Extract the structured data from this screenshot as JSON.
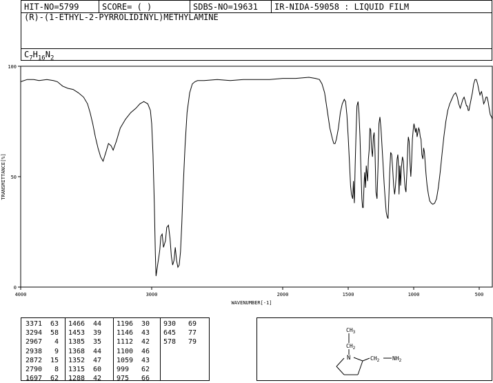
{
  "header": {
    "hit_no": "HIT-NO=5799",
    "score": "SCORE=  (   )",
    "sdbs_no": "SDBS-NO=19631",
    "ir_info": "IR-NIDA-59058 : LIQUID FILM"
  },
  "compound_name": "(R)-(1-ETHYL-2-PYRROLIDINYL)METHYLAMINE",
  "formula": {
    "parts": [
      "C",
      "7",
      "H",
      "16",
      "N",
      "2"
    ]
  },
  "chart_data": {
    "type": "line",
    "title": "",
    "xlabel": "WAVENUMBER[-1]",
    "ylabel": "TRANSMITTANCE[%]",
    "xlim": [
      4000,
      400
    ],
    "ylim": [
      0,
      100
    ],
    "x_ticks": [
      4000,
      3000,
      2000,
      1500,
      1000,
      500
    ],
    "y_ticks": [
      0,
      50,
      100
    ],
    "grid": false,
    "series": [
      {
        "points": [
          [
            4000,
            93
          ],
          [
            3950,
            94
          ],
          [
            3900,
            94
          ],
          [
            3860,
            93.5
          ],
          [
            3800,
            94
          ],
          [
            3750,
            93.5
          ],
          [
            3720,
            93
          ],
          [
            3700,
            92
          ],
          [
            3680,
            91
          ],
          [
            3640,
            90
          ],
          [
            3600,
            89.5
          ],
          [
            3560,
            88
          ],
          [
            3520,
            86
          ],
          [
            3490,
            83
          ],
          [
            3470,
            79
          ],
          [
            3450,
            74
          ],
          [
            3430,
            68
          ],
          [
            3410,
            63
          ],
          [
            3390,
            59
          ],
          [
            3371,
            57
          ],
          [
            3350,
            61
          ],
          [
            3330,
            65
          ],
          [
            3310,
            64
          ],
          [
            3294,
            62
          ],
          [
            3270,
            66
          ],
          [
            3240,
            72
          ],
          [
            3200,
            76
          ],
          [
            3160,
            79
          ],
          [
            3120,
            81
          ],
          [
            3090,
            83
          ],
          [
            3060,
            84
          ],
          [
            3030,
            83
          ],
          [
            3010,
            80
          ],
          [
            3000,
            74
          ],
          [
            2990,
            60
          ],
          [
            2980,
            38
          ],
          [
            2972,
            15
          ],
          [
            2967,
            5
          ],
          [
            2955,
            10
          ],
          [
            2945,
            14
          ],
          [
            2938,
            17
          ],
          [
            2930,
            23
          ],
          [
            2920,
            24
          ],
          [
            2910,
            18
          ],
          [
            2895,
            21
          ],
          [
            2885,
            27
          ],
          [
            2872,
            28
          ],
          [
            2860,
            22
          ],
          [
            2850,
            14
          ],
          [
            2840,
            10
          ],
          [
            2830,
            12
          ],
          [
            2820,
            18
          ],
          [
            2810,
            12
          ],
          [
            2800,
            9
          ],
          [
            2790,
            10
          ],
          [
            2780,
            16
          ],
          [
            2770,
            29
          ],
          [
            2760,
            45
          ],
          [
            2745,
            64
          ],
          [
            2730,
            79
          ],
          [
            2710,
            88
          ],
          [
            2690,
            92
          ],
          [
            2670,
            93
          ],
          [
            2650,
            93.5
          ],
          [
            2600,
            93.5
          ],
          [
            2500,
            94
          ],
          [
            2400,
            93.5
          ],
          [
            2300,
            94
          ],
          [
            2200,
            94
          ],
          [
            2100,
            94
          ],
          [
            2000,
            94.5
          ],
          [
            1900,
            94.5
          ],
          [
            1800,
            95
          ],
          [
            1750,
            94.5
          ],
          [
            1720,
            94
          ],
          [
            1700,
            92
          ],
          [
            1680,
            88
          ],
          [
            1660,
            80
          ],
          [
            1640,
            72
          ],
          [
            1620,
            67
          ],
          [
            1610,
            65
          ],
          [
            1600,
            65
          ],
          [
            1590,
            67
          ],
          [
            1575,
            72
          ],
          [
            1560,
            79
          ],
          [
            1545,
            83
          ],
          [
            1530,
            85
          ],
          [
            1520,
            84
          ],
          [
            1510,
            78
          ],
          [
            1500,
            68
          ],
          [
            1490,
            56
          ],
          [
            1482,
            46
          ],
          [
            1475,
            42
          ],
          [
            1466,
            40
          ],
          [
            1460,
            48
          ],
          [
            1453,
            38
          ],
          [
            1447,
            55
          ],
          [
            1440,
            70
          ],
          [
            1433,
            82
          ],
          [
            1425,
            84
          ],
          [
            1418,
            79
          ],
          [
            1410,
            68
          ],
          [
            1402,
            52
          ],
          [
            1396,
            40
          ],
          [
            1390,
            36
          ],
          [
            1385,
            36
          ],
          [
            1378,
            48
          ],
          [
            1374,
            52
          ],
          [
            1368,
            45
          ],
          [
            1362,
            55
          ],
          [
            1358,
            52
          ],
          [
            1352,
            48
          ],
          [
            1346,
            58
          ],
          [
            1340,
            62
          ],
          [
            1334,
            72
          ],
          [
            1328,
            71
          ],
          [
            1322,
            63
          ],
          [
            1315,
            59
          ],
          [
            1308,
            68
          ],
          [
            1302,
            70
          ],
          [
            1296,
            62
          ],
          [
            1288,
            43
          ],
          [
            1280,
            40
          ],
          [
            1272,
            55
          ],
          [
            1265,
            74
          ],
          [
            1258,
            77
          ],
          [
            1250,
            72
          ],
          [
            1242,
            64
          ],
          [
            1234,
            56
          ],
          [
            1226,
            47
          ],
          [
            1218,
            40
          ],
          [
            1210,
            34
          ],
          [
            1203,
            32
          ],
          [
            1196,
            31
          ],
          [
            1190,
            40
          ],
          [
            1183,
            52
          ],
          [
            1176,
            61
          ],
          [
            1168,
            60
          ],
          [
            1160,
            53
          ],
          [
            1153,
            46
          ],
          [
            1146,
            42
          ],
          [
            1140,
            45
          ],
          [
            1134,
            50
          ],
          [
            1127,
            58
          ],
          [
            1121,
            60
          ],
          [
            1116,
            55
          ],
          [
            1112,
            42
          ],
          [
            1106,
            55
          ],
          [
            1100,
            46
          ],
          [
            1094,
            54
          ],
          [
            1086,
            59
          ],
          [
            1079,
            57
          ],
          [
            1072,
            50
          ],
          [
            1066,
            45
          ],
          [
            1059,
            43
          ],
          [
            1052,
            52
          ],
          [
            1046,
            63
          ],
          [
            1041,
            68
          ],
          [
            1035,
            66
          ],
          [
            1028,
            56
          ],
          [
            1022,
            50
          ],
          [
            1016,
            57
          ],
          [
            1010,
            67
          ],
          [
            1004,
            71
          ],
          [
            998,
            74
          ],
          [
            992,
            72
          ],
          [
            986,
            70
          ],
          [
            982,
            72
          ],
          [
            978,
            71
          ],
          [
            974,
            68
          ],
          [
            968,
            70
          ],
          [
            962,
            72
          ],
          [
            956,
            71
          ],
          [
            950,
            68
          ],
          [
            944,
            67
          ],
          [
            938,
            60
          ],
          [
            930,
            58
          ],
          [
            924,
            63
          ],
          [
            918,
            61
          ],
          [
            912,
            56
          ],
          [
            906,
            51
          ],
          [
            898,
            46
          ],
          [
            888,
            42
          ],
          [
            878,
            39
          ],
          [
            866,
            38
          ],
          [
            854,
            37.5
          ],
          [
            840,
            38
          ],
          [
            826,
            40
          ],
          [
            812,
            45
          ],
          [
            798,
            52
          ],
          [
            784,
            60
          ],
          [
            770,
            68
          ],
          [
            755,
            75
          ],
          [
            740,
            80
          ],
          [
            725,
            83
          ],
          [
            710,
            85
          ],
          [
            695,
            87
          ],
          [
            680,
            88
          ],
          [
            667,
            86
          ],
          [
            657,
            83
          ],
          [
            645,
            81
          ],
          [
            635,
            83
          ],
          [
            625,
            85
          ],
          [
            615,
            86
          ],
          [
            605,
            84
          ],
          [
            597,
            82
          ],
          [
            590,
            82
          ],
          [
            584,
            80
          ],
          [
            578,
            80
          ],
          [
            572,
            82
          ],
          [
            562,
            85
          ],
          [
            552,
            88
          ],
          [
            542,
            92
          ],
          [
            532,
            94
          ],
          [
            522,
            94
          ],
          [
            512,
            92
          ],
          [
            502,
            89
          ],
          [
            494,
            87
          ],
          [
            488,
            88
          ],
          [
            482,
            88.5
          ],
          [
            474,
            86
          ],
          [
            466,
            83
          ],
          [
            458,
            84
          ],
          [
            448,
            86
          ],
          [
            440,
            86
          ],
          [
            432,
            84
          ],
          [
            424,
            81
          ],
          [
            415,
            78
          ],
          [
            405,
            77
          ],
          [
            400,
            76
          ]
        ]
      }
    ]
  },
  "peak_table": {
    "columns": [
      [
        [
          "3371",
          "63"
        ],
        [
          "3294",
          "58"
        ],
        [
          "2967",
          "4"
        ],
        [
          "2938",
          "9"
        ],
        [
          "2872",
          "15"
        ],
        [
          "2790",
          "8"
        ],
        [
          "1697",
          "62"
        ]
      ],
      [
        [
          "1466",
          "44"
        ],
        [
          "1453",
          "39"
        ],
        [
          "1385",
          "35"
        ],
        [
          "1368",
          "44"
        ],
        [
          "1352",
          "47"
        ],
        [
          "1315",
          "60"
        ],
        [
          "1288",
          "42"
        ]
      ],
      [
        [
          "1196",
          "30"
        ],
        [
          "1146",
          "43"
        ],
        [
          "1112",
          "42"
        ],
        [
          "1100",
          "46"
        ],
        [
          "1059",
          "43"
        ],
        [
          "999",
          "62"
        ],
        [
          "975",
          "66"
        ]
      ],
      [
        [
          "930",
          "69"
        ],
        [
          "645",
          "77"
        ],
        [
          "578",
          "79"
        ]
      ]
    ]
  },
  "structure": {
    "label_ch3": "CH",
    "label_ch3_sub": "3",
    "label_ch2_top": "CH",
    "label_ch2_top_sub": "2",
    "label_n": "N",
    "label_ch2_side": "CH",
    "label_ch2_side_sub": "2",
    "label_nh2": "NH",
    "label_nh2_sub": "2"
  }
}
